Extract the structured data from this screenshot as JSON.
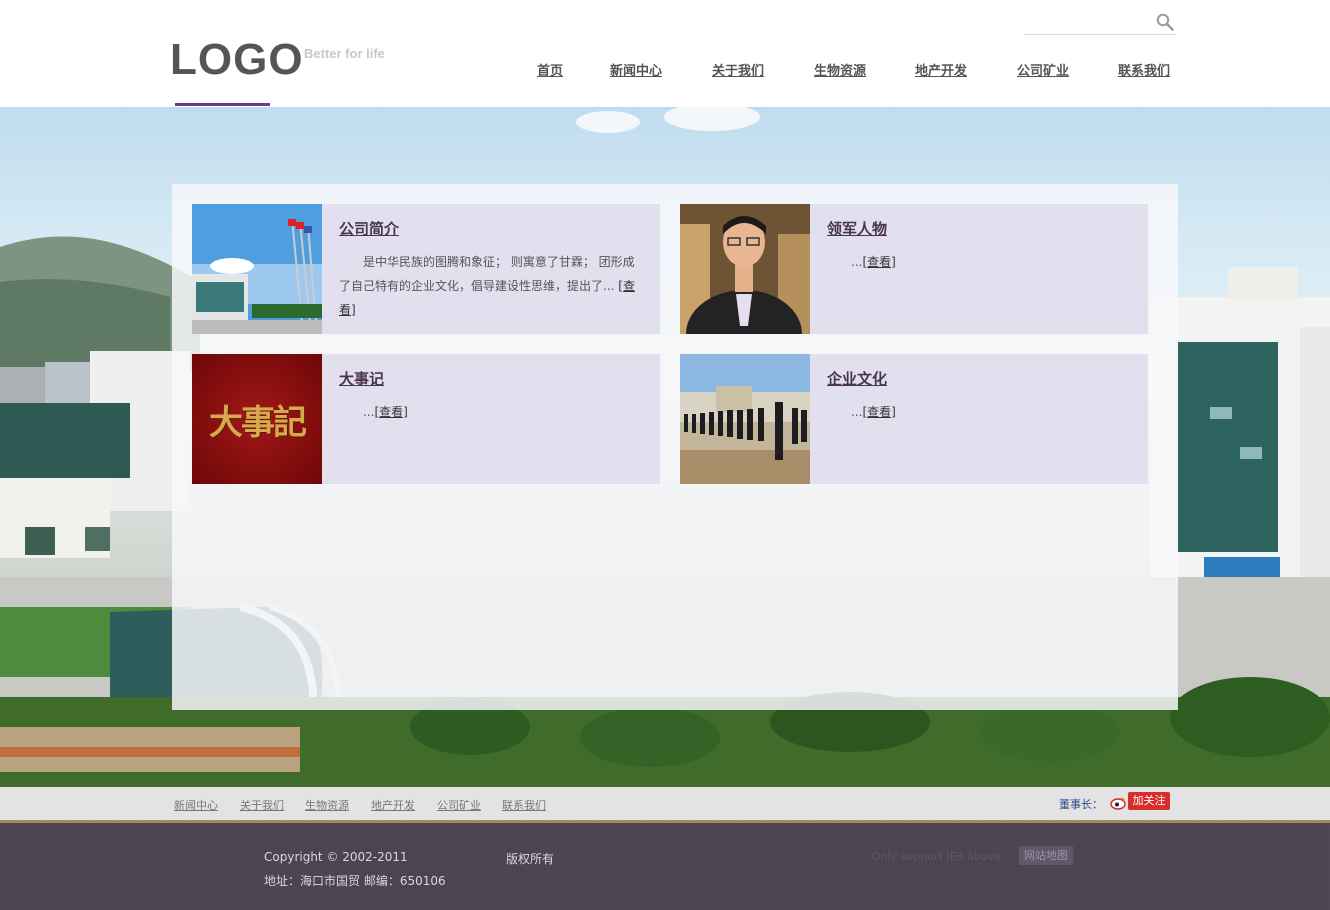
{
  "header": {
    "logo": "LOGO",
    "tagline": "Better for life",
    "search_icon": "search-icon",
    "nav": [
      "首页",
      "新闻中心",
      "关于我们",
      "生物资源",
      "地产开发",
      "公司矿业",
      "联系我们"
    ]
  },
  "cards": [
    {
      "title": "公司简介",
      "desc": "是中华民族的图腾和象征； 则寓意了甘霖； 团形成了自己特有的企业文化，倡导建设性思维，提出了...",
      "more": "[查看]",
      "image": "company-building-photo"
    },
    {
      "title": "领军人物",
      "desc": "...",
      "more": "[查看]",
      "image": "leader-portrait-photo"
    },
    {
      "title": "大事记",
      "desc": "...",
      "more": "[查看]",
      "image": "milestones-calligraphy-photo",
      "image_text": "大事記"
    },
    {
      "title": "企业文化",
      "desc": "...",
      "more": "[查看]",
      "image": "staff-lineup-photo"
    }
  ],
  "footer": {
    "nav": [
      "新闻中心",
      "关于我们",
      "生物资源",
      "地产开发",
      "公司矿业",
      "联系我们"
    ],
    "weibo_label": "董事长：",
    "weibo_follow": "加关注",
    "copyright": "Copyright © 2002-2011",
    "rights": "版权所有",
    "address": "地址：海口市国贸 邮编：650106",
    "support": "Only support IE6 above",
    "sitemap": "网站地图"
  },
  "colors": {
    "accent": "#6b3a8c",
    "card_bg": "#e2e0ee",
    "footer_bg": "#4a4352",
    "footer_bar": "#e3e3e3",
    "weibo_red": "#d92c2c"
  }
}
